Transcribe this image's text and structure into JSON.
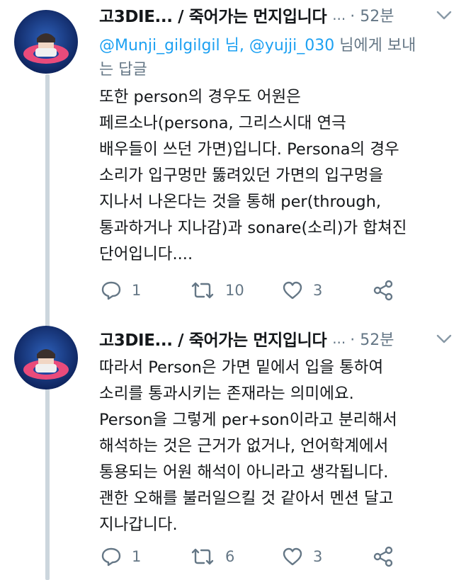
{
  "tweets": [
    {
      "display_name": "고3DIE... / 죽어가는 먼지입니다",
      "ellipsis": "...",
      "time": "· 52분",
      "reply_prefix": "",
      "reply_mention_1": "@Munji_gilgilgil",
      "reply_mid": " 님, ",
      "reply_mention_2": "@yujji_030",
      "reply_suffix": " 님에게 보내는 답글",
      "lines": [
        "또한 person의 경우도 어원은",
        "페르소나(persona, 그리스시대 연극",
        "배우들이 쓰던 가면)입니다. Persona의 경우",
        "소리가 입구멍만 뚫려있던 가면의 입구멍을",
        "지나서 나온다는 것을 통해 per(through,",
        "통과하거나 지나감)과 sonare(소리)가 합쳐진",
        "단어입니다...."
      ],
      "replies": "1",
      "retweets": "10",
      "likes": "3"
    },
    {
      "display_name": "고3DIE... / 죽어가는 먼지입니다",
      "ellipsis": "...",
      "time": "· 52분",
      "lines": [
        "따라서 Person은 가면 밑에서 입을 통하여",
        "소리를 통과시키는 존재라는 의미에요.",
        "Person을 그렇게 per+son이라고 분리해서",
        "해석하는 것은 근거가 없거나, 언어학계에서",
        "통용되는 어원 해석이 아니라고 생각됩니다.",
        "괜한 오해를 불러일으킬 것 같아서 멘션 달고",
        "지나갑니다."
      ],
      "replies": "1",
      "retweets": "6",
      "likes": "3"
    }
  ],
  "icons": {
    "reply": "reply-icon",
    "retweet": "retweet-icon",
    "like": "heart-icon",
    "share": "share-icon",
    "menu": "chevron-down-icon"
  },
  "colors": {
    "link": "#1da1f2",
    "muted": "#657786",
    "text": "#14171a",
    "thread_line": "#ccd6dd"
  }
}
